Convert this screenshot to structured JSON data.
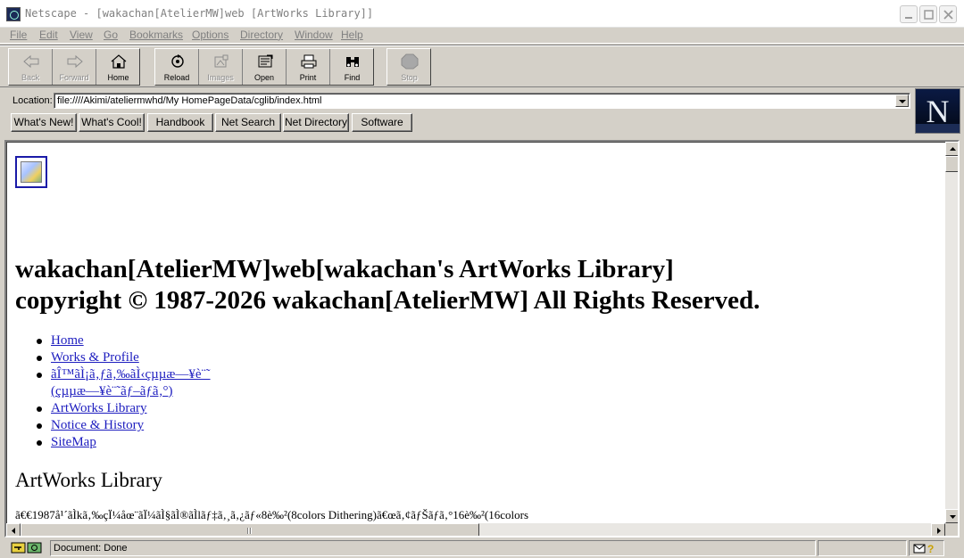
{
  "window": {
    "title": "Netscape - [wakachan[AtelierMW]web [ArtWorks Library]]",
    "controls": [
      "minimize",
      "maximize",
      "close"
    ]
  },
  "menu": [
    "File",
    "Edit",
    "View",
    "Go",
    "Bookmarks",
    "Options",
    "Directory",
    "Window",
    "Help"
  ],
  "toolbar": {
    "back": "Back",
    "forward": "Forward",
    "home": "Home",
    "reload": "Reload",
    "images": "Images",
    "open": "Open",
    "print": "Print",
    "find": "Find",
    "stop": "Stop"
  },
  "location": {
    "label": "Location:",
    "value": "file:////Akimi/ateliermwhd/My HomePageData/cglib/index.html"
  },
  "directory_buttons": [
    "What's New!",
    "What's Cool!",
    "Handbook",
    "Net Search",
    "Net Directory",
    "Software"
  ],
  "logo": {
    "letter": "N"
  },
  "page": {
    "heading_line1": "wakachan[AtelierMW]web[wakachan's ArtWorks Library]",
    "heading_line2": "copyright © 1987-2026 wakachan[AtelierMW] All Rights Reserved.",
    "nav": [
      "Home",
      "Works & Profile",
      "ãÎ™ãÌ¡ã‚ƒã‚‰ãÌ‹çµµæ—¥è¨˜",
      "(çµµæ—¥è¨˜ãƒ–ãƒ­ã‚°)",
      "ArtWorks Library",
      "Notice & History",
      "SiteMap"
    ],
    "section_title": "ArtWorks Library",
    "paragraph": "ã€€1987å¹´ãÌkã‚‰çÏ¼åœ¨ãÏ¼ãÌ§ãÌ®ãÌlãƒ‡ã‚¸ã‚¿ãƒ«8è‰²(8colors Dithering)ã€œã‚¢ãƒŠãƒ­ã‚°16è‰²(16colors"
  },
  "status": {
    "text": "Document: Done"
  }
}
